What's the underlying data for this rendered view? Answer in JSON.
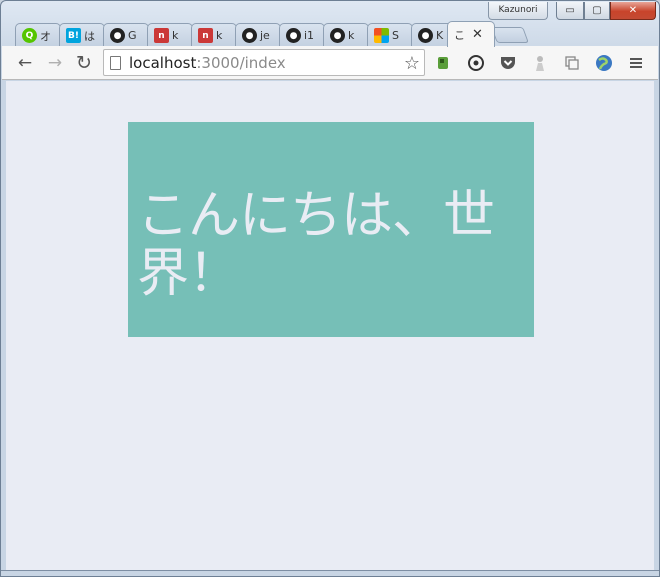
{
  "window": {
    "profile_name": "Kazunori",
    "controls": {
      "minimize": "▭",
      "maximize": "▢",
      "close": "✕"
    }
  },
  "tabs": [
    {
      "title": "オ",
      "icon": "qiita-icon",
      "color": "#55c500"
    },
    {
      "title": "は",
      "icon": "hatena-bookmark-icon",
      "color": "#00a4de"
    },
    {
      "title": "G",
      "icon": "github-icon",
      "color": "#222222"
    },
    {
      "title": "k",
      "icon": "npm-icon",
      "color": "#cb3837"
    },
    {
      "title": "k",
      "icon": "npm-icon",
      "color": "#cb3837"
    },
    {
      "title": "je",
      "icon": "github-icon",
      "color": "#222222"
    },
    {
      "title": "i1",
      "icon": "github-icon",
      "color": "#222222"
    },
    {
      "title": "k",
      "icon": "github-icon",
      "color": "#222222"
    },
    {
      "title": "S",
      "icon": "microsoft-icon",
      "color": "#f25022"
    },
    {
      "title": "K",
      "icon": "github-icon",
      "color": "#222222"
    },
    {
      "title": "こ",
      "icon": "",
      "color": "",
      "active": true
    }
  ],
  "toolbar": {
    "back": "←",
    "forward": "→",
    "reload": "↻",
    "url_host": "localhost",
    "url_path": ":3000/index",
    "extensions": [
      "evernote-icon",
      "pocket-target-icon",
      "pocket-icon",
      "bookmark-person-icon",
      "copy-icon",
      "globe-icon",
      "menu-icon"
    ]
  },
  "page": {
    "heading": "こんにちは、世界！",
    "box_color": "#76bfb7",
    "text_color": "#e9ecf4",
    "background": "#e9ecf4"
  }
}
